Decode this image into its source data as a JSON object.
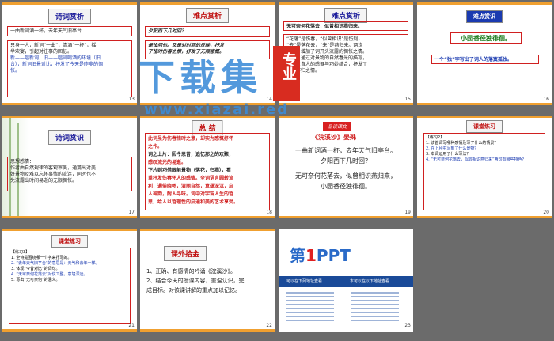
{
  "slides": [
    {
      "num": "13",
      "title": "诗词赏析",
      "lines": [
        "一曲新词酒一杯，去年天气旧亭台",
        "只身一人，新词“一曲”，清酒“一杯”，摇",
        "举欢宴，引起对往事的回忆。",
        "新——唱新词，旧——唱词喝酒的环境（旧",
        "台），新词旧景对比，抒发了今天是昨非的惆",
        "怅。"
      ]
    },
    {
      "num": "14",
      "title": "难点赏析",
      "question": "夕阳西下几时回？",
      "lines": [
        "是设问句。又是对时间的反映，抒发",
        "了惜时伤春之情，抒发了无限感慨。"
      ]
    },
    {
      "num": "15",
      "title": "难点赏析",
      "head": "无可奈何花落去，似曾相识燕归来。",
      "lines": [
        "“花落”是伤春，“似曾相识”是伤别，",
        "“去”是落花去，“来”是燕归来。两次",
        "对比，增加了词开头流露的惆怅之情。",
        "赏析：通过对景物的自然春光的描写，",
        "表现发自人的感慨与巧妙结合，抒发了",
        "伤别怀归之情。"
      ]
    },
    {
      "num": "16",
      "title": "难点赏识",
      "highlight": "小园香径独徘徊。",
      "note": "一个“独”字写出了词人的落寞孤独。"
    },
    {
      "num": "17",
      "title": "诗词赏识",
      "lines": [
        "思想感情：",
        "作者由自然规律的客观审美，通篇出对美",
        "好景物及难以忘怀事情的流连，同时也不",
        "免流露出时间易逝的无限惆怅。"
      ]
    },
    {
      "num": "18",
      "title": "总 结",
      "lines": [
        "此词虽为伤春惜时之意，却实为感慨抒怀",
        "之作。",
        "词之上片：因今思昔，追忆那之的欢聚，",
        "感叹流光的易逝。",
        "下片则巧借眼前景物（落花，归燕），看",
        "重抒发伤春怀人的感情。全词语言圆转流",
        "利，通俗晓畅，清丽自然，意蕴深沉，启",
        "人神韵，耐人寻味。词中对宇宙人生的哲",
        "思，给人以哲理性的启迪和美的艺术享受。"
      ]
    },
    {
      "num": "19",
      "badge": "品读课文",
      "title": "《浣溪沙》晏殊",
      "lines": [
        "一曲新词酒一杯，去年天气旧亭台。",
        "夕阳西下几时回？",
        "无可奈何花落去，似曾相识燕归来，",
        "小园香径独徘徊。"
      ]
    },
    {
      "num": "20",
      "title": "课堂练习",
      "lines": [
        "【练习2】",
        "1. 该首词写哪种感情及写了什么的情景？",
        "2. 在上片中写到了什么景物？",
        "3. 本词运用了什么写法？",
        "4. “无可奈何花落去，似曾相识燕归来”两句有哪些特色？"
      ]
    },
    {
      "num": "21",
      "title": "课堂练习",
      "lines": [
        "【练习3】",
        "1. 全诗是围绕哪一个字来抒写的。",
        "2. “去年天气旧亭台”的意思是：天气和去年一样。",
        "3. 体现“今昔对比”的词句。",
        "4. “无可奈何花落去”对仗工整，意境深远。",
        "5. 写出“无可奈何”的涵义。"
      ]
    },
    {
      "num": "22",
      "title": "课外拾金",
      "lines": [
        "1、正确、有感情的吟诵《浣溪沙》。",
        "2、结合今天的授课内容，重温认识，完",
        "成目标。对该课讲解的重点加以记忆。"
      ]
    },
    {
      "num": "23",
      "logo_big": "第",
      "logo_one": "1",
      "logo_ppt": "PPT",
      "caption": "可以在下列地址查看",
      "caption2": "本可以在以下地址查看"
    }
  ],
  "watermark": {
    "big": "下载集",
    "side": "专业",
    "url": "www.xiazai.red"
  }
}
